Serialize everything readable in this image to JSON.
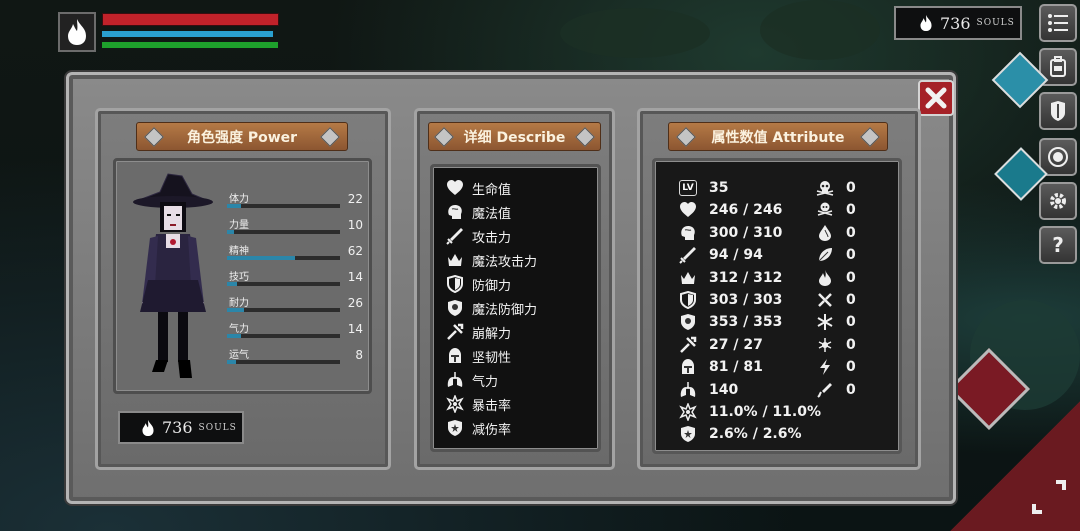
{
  "hud": {
    "hp_fraction": 1.0,
    "mp_fraction": 0.97,
    "stamina_fraction": 1.0
  },
  "souls": {
    "count": "736",
    "word": "SOULS"
  },
  "panels": {
    "power_title": "角色强度 Power",
    "describe_title": "详细 Describe",
    "attribute_title": "属性数值 Attribute"
  },
  "stats": [
    {
      "label": "体力",
      "value": "22",
      "fill": 0.12
    },
    {
      "label": "力量",
      "value": "10",
      "fill": 0.06
    },
    {
      "label": "精神",
      "value": "62",
      "fill": 0.6
    },
    {
      "label": "技巧",
      "value": "14",
      "fill": 0.09
    },
    {
      "label": "耐力",
      "value": "26",
      "fill": 0.15
    },
    {
      "label": "气力",
      "value": "14",
      "fill": 0.12
    },
    {
      "label": "运气",
      "value": "8",
      "fill": 0.08
    }
  ],
  "describe": [
    {
      "icon": "heart-icon",
      "label": "生命值"
    },
    {
      "icon": "brain-icon",
      "label": "魔法值"
    },
    {
      "icon": "sword-icon",
      "label": "攻击力"
    },
    {
      "icon": "crown-icon",
      "label": "魔法攻击力"
    },
    {
      "icon": "shield-icon",
      "label": "防御力"
    },
    {
      "icon": "magic-shield-icon",
      "label": "魔法防御力"
    },
    {
      "icon": "break-icon",
      "label": "崩解力"
    },
    {
      "icon": "helmet-icon",
      "label": "坚韧性"
    },
    {
      "icon": "lungs-icon",
      "label": "气力"
    },
    {
      "icon": "star-burst-icon",
      "label": "暴击率"
    },
    {
      "icon": "shield-star-icon",
      "label": "减伤率"
    }
  ],
  "attributes_left": [
    {
      "icon": "level-icon",
      "value": "35"
    },
    {
      "icon": "heart-icon",
      "value": "246 / 246"
    },
    {
      "icon": "brain-icon",
      "value": "300 / 310"
    },
    {
      "icon": "sword-icon",
      "value": "94 / 94"
    },
    {
      "icon": "crown-icon",
      "value": "312 / 312"
    },
    {
      "icon": "shield-icon",
      "value": "303 / 303"
    },
    {
      "icon": "magic-shield-icon",
      "value": "353 / 353"
    },
    {
      "icon": "break-icon",
      "value": "27 / 27"
    },
    {
      "icon": "helmet-icon",
      "value": "81 / 81"
    },
    {
      "icon": "lungs-icon",
      "value": "140"
    },
    {
      "icon": "star-burst-icon",
      "value": "11.0% / 11.0%"
    },
    {
      "icon": "shield-star-icon",
      "value": "2.6% / 2.6%"
    }
  ],
  "attributes_right": [
    {
      "icon": "skull-icon",
      "value": "0"
    },
    {
      "icon": "skull-drip-icon",
      "value": "0"
    },
    {
      "icon": "drop-icon",
      "value": "0"
    },
    {
      "icon": "leaf-icon",
      "value": "0"
    },
    {
      "icon": "fire-icon",
      "value": "0"
    },
    {
      "icon": "slash-icon",
      "value": "0"
    },
    {
      "icon": "snowflake-icon",
      "value": "0"
    },
    {
      "icon": "frost-icon",
      "value": "0"
    },
    {
      "icon": "lightning-icon",
      "value": "0"
    },
    {
      "icon": "bleed-icon",
      "value": "0"
    }
  ]
}
